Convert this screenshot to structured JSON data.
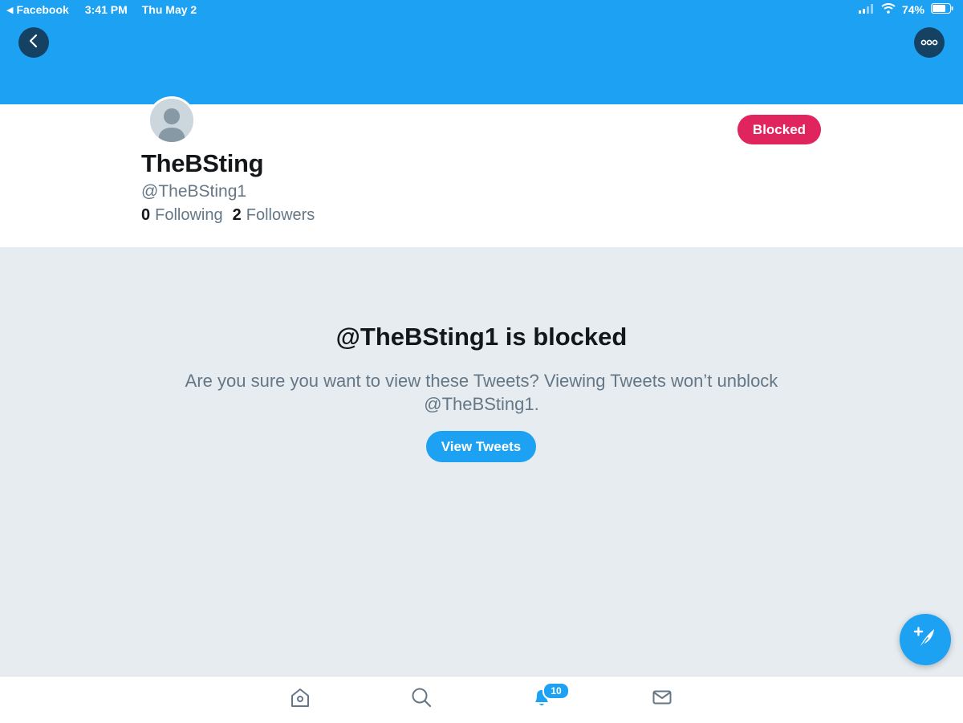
{
  "status_bar": {
    "back_app": "Facebook",
    "time": "3:41 PM",
    "date": "Thu May 2",
    "battery": "74%"
  },
  "profile": {
    "display_name": "TheBSting",
    "handle": "@TheBSting1",
    "following_count": "0",
    "following_label": "Following",
    "followers_count": "2",
    "followers_label": "Followers",
    "blocked_button": "Blocked"
  },
  "blocked_notice": {
    "title": "@TheBSting1 is blocked",
    "message": "Are you sure you want to view these Tweets? Viewing Tweets won’t unblock @TheBSting1.",
    "view_button": "View Tweets"
  },
  "tab_bar": {
    "notifications_badge": "10",
    "icons": [
      "home-icon",
      "search-icon",
      "notifications-bell-icon",
      "messages-envelope-icon"
    ]
  },
  "colors": {
    "brand_blue": "#1da1f2",
    "blocked_red": "#e0245e",
    "notice_bg": "#e6ecf0",
    "secondary_text": "#657786",
    "primary_text": "#14171a"
  }
}
